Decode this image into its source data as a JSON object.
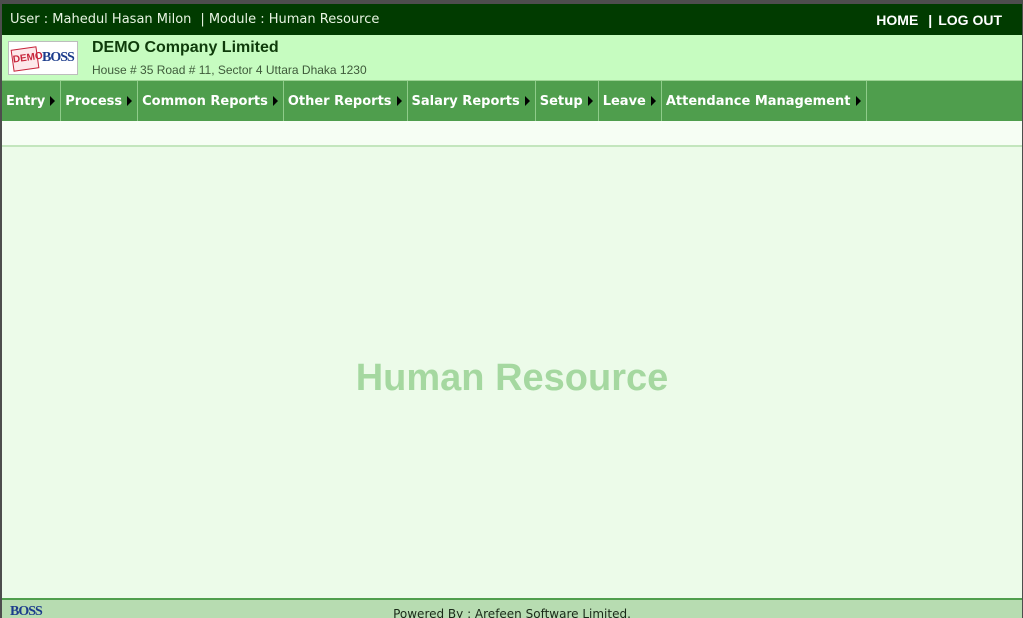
{
  "topbar": {
    "user_label": "User : Mahedul Hasan Milon",
    "module_label": "Module : Human Resource",
    "home_link": "HOME",
    "logout_link": "LOG OUT",
    "separator": "|"
  },
  "header": {
    "logo_demo_text": "DEMO",
    "logo_boss_text": "BOSS",
    "company_name": "DEMO Company Limited",
    "company_address": "House # 35 Road # 11, Sector 4 Uttara Dhaka 1230"
  },
  "menu": {
    "items": [
      {
        "label": "Entry"
      },
      {
        "label": "Process"
      },
      {
        "label": "Common Reports"
      },
      {
        "label": "Other Reports"
      },
      {
        "label": "Salary Reports"
      },
      {
        "label": "Setup"
      },
      {
        "label": "Leave"
      },
      {
        "label": "Attendance Management"
      }
    ]
  },
  "main": {
    "watermark": "Human Resource"
  },
  "footer": {
    "powered_by": "Powered By : Arefeen Software Limited.",
    "logo_text": "BOSS"
  },
  "colors": {
    "topbar_bg": "#013b00",
    "header_bg": "#c6fcc0",
    "menu_bg": "#4f9e4d",
    "main_bg": "#ecfbe9",
    "watermark": "#a5d8a0",
    "footer_bg": "#b7dcb1"
  },
  "icons": {
    "menu_arrow": "caret-right-icon"
  }
}
